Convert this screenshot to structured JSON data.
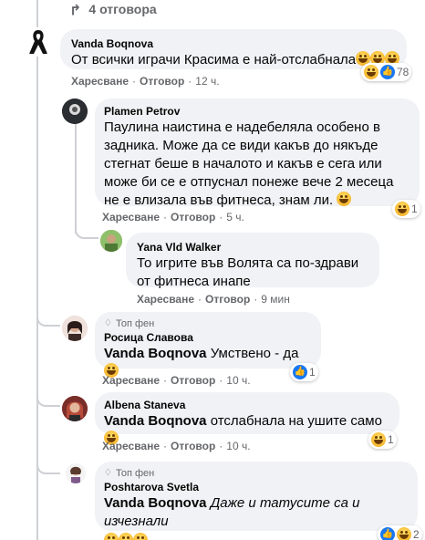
{
  "thread": {
    "replies_label": "4 отговора"
  },
  "c1": {
    "author": "Vanda Boqnova",
    "text": "От всички играчи Красима е най-отслабнала",
    "reaction_count": "78",
    "like": "Харесване",
    "reply": "Отговор",
    "time": "12 ч."
  },
  "c2": {
    "author": "Plamen Petrov",
    "text": "Паулина наистина е надебеляла особено в задника. Може да се види какъв до някъде стегнат беше в началото и какъв е сега или може би се е отпуснал понеже вече 2 месеца не е влизала във фитнеса, знам ли.",
    "reaction_count": "1",
    "like": "Харесване",
    "reply": "Отговор",
    "time": "5 ч."
  },
  "c3": {
    "author": "Yana Vld Walker",
    "text": "То игрите във Волята са по-здрави от фитнеса инапе",
    "like": "Харесване",
    "reply": "Отговор",
    "time": "9 мин"
  },
  "c4": {
    "badge": "Топ фен",
    "author": "Росица Славова",
    "mention": "Vanda Boqnova",
    "text": "Умствено - да",
    "reaction_count": "1",
    "like": "Харесване",
    "reply": "Отговор",
    "time": "10 ч."
  },
  "c5": {
    "author": "Albena Staneva",
    "mention": "Vanda Boqnova",
    "text": "отслабнала на ушите само",
    "reaction_count": "1",
    "like": "Харесване",
    "reply": "Отговор",
    "time": "10 ч."
  },
  "c6": {
    "badge": "Топ фен",
    "author": "Poshtarova Svetla",
    "mention": "Vanda Boqnova",
    "text": "Даже и татусите са и изчезнали",
    "reaction_count": "2"
  },
  "colors": {
    "bubble": "#f0f2f5",
    "meta": "#65676b",
    "like_blue": "#1877f2"
  }
}
